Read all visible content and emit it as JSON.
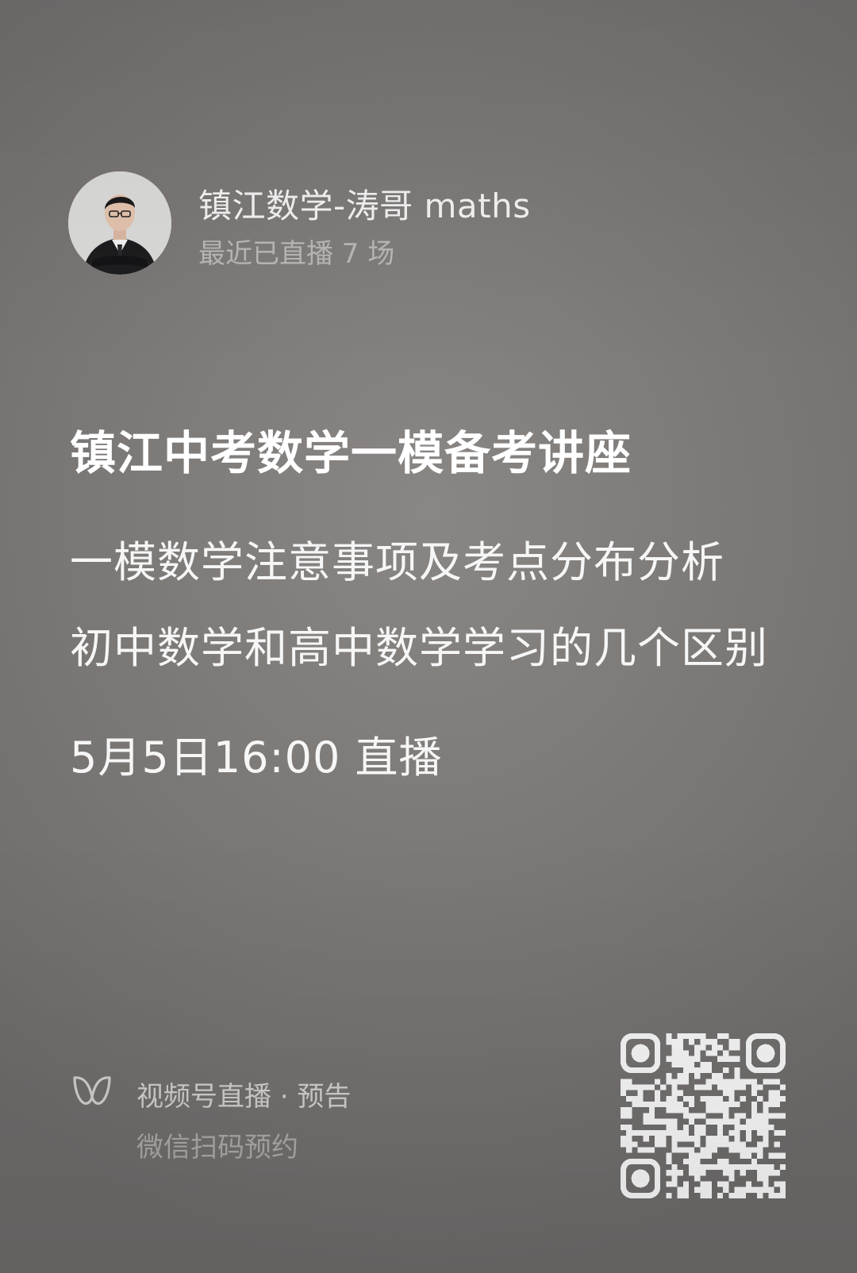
{
  "host": {
    "name": "镇江数学-涛哥 maths",
    "meta": "最近已直播 7 场",
    "avatar_icon": "person-portrait"
  },
  "event": {
    "title": "镇江中考数学一模备考讲座",
    "topics": [
      "一模数学注意事项及考点分布分析",
      "初中数学和高中数学学习的几个区别"
    ],
    "schedule": "5月5日16:00 直播"
  },
  "footer": {
    "icon": "channels-butterfly-icon",
    "title": "视频号直播 · 预告",
    "subtitle": "微信扫码预约",
    "qr_icon": "qr-code"
  }
}
